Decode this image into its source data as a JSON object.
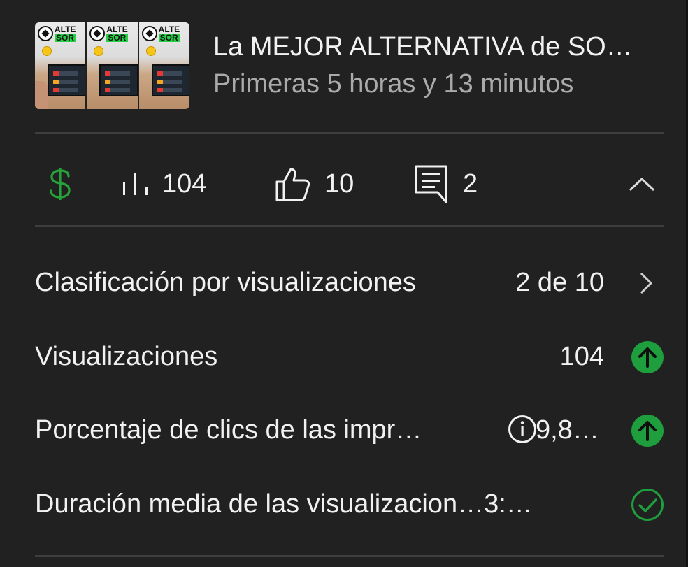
{
  "video": {
    "title": "La MEJOR ALTERNATIVA de SO…",
    "subtitle": "Primeras 5 horas y 13 minutos",
    "thumbnail_brand_line1": "ALTE",
    "thumbnail_brand_line2": "SOR"
  },
  "stats": {
    "monetization_icon": "dollar-icon",
    "views_icon": "bar-chart-icon",
    "views": "104",
    "likes_icon": "thumbs-up-icon",
    "likes": "10",
    "comments_icon": "comment-icon",
    "comments": "2",
    "collapse_icon": "chevron-up-icon",
    "accent_color": "#27a23a"
  },
  "metrics": [
    {
      "label": "Clasificación por visualizaciones",
      "value": "2 de 10",
      "icon": "chevron-right-icon"
    },
    {
      "label": "Visualizaciones",
      "value": "104",
      "icon": "arrow-up-circle-icon",
      "icon_color": "#1e9e3c"
    },
    {
      "label": "Porcentaje de clics de las impr…",
      "info_icon": "info-icon",
      "value": "9,8…",
      "icon": "arrow-up-circle-icon",
      "icon_color": "#1e9e3c"
    },
    {
      "label": "Duración media de las visualizacion…3:…",
      "icon": "check-circle-icon",
      "icon_color": "#1e9e3c"
    }
  ]
}
